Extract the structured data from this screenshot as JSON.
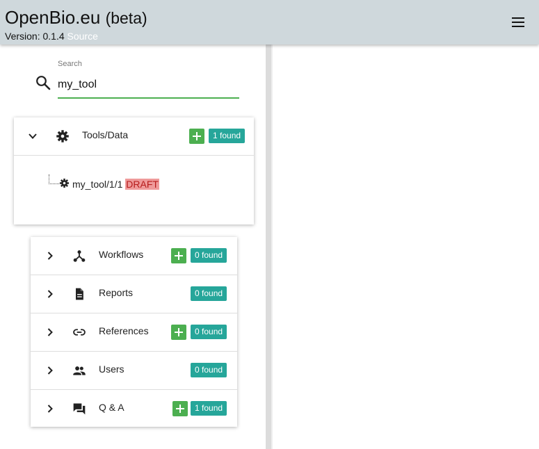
{
  "header": {
    "brand": "OpenBio.eu",
    "beta": "(beta)",
    "version_label": "Version: 0.1.4",
    "source_label": "Source",
    "menu_icon": "hamburger-menu-icon"
  },
  "search": {
    "label": "Search",
    "value": "my_tool",
    "icon": "search-icon"
  },
  "tools": {
    "label": "Tools/Data",
    "icon": "gear-icon",
    "found": "1 found",
    "items": [
      {
        "label": "my_tool/1/1",
        "status": "DRAFT",
        "icon": "gear-icon"
      }
    ]
  },
  "sections": [
    {
      "label": "Workflows",
      "icon": "workflow-icon",
      "found": "0 found",
      "has_add": true
    },
    {
      "label": "Reports",
      "icon": "report-icon",
      "found": "0 found",
      "has_add": false
    },
    {
      "label": "References",
      "icon": "link-icon",
      "found": "0 found",
      "has_add": true
    },
    {
      "label": "Users",
      "icon": "users-icon",
      "found": "0 found",
      "has_add": false
    },
    {
      "label": "Q & A",
      "icon": "forum-icon",
      "found": "1 found",
      "has_add": true
    }
  ],
  "colors": {
    "header_bg": "#cfd8dc",
    "accent_green": "#4caf50",
    "badge_teal": "#26a69a",
    "draft_bg": "#ef9a9a"
  }
}
